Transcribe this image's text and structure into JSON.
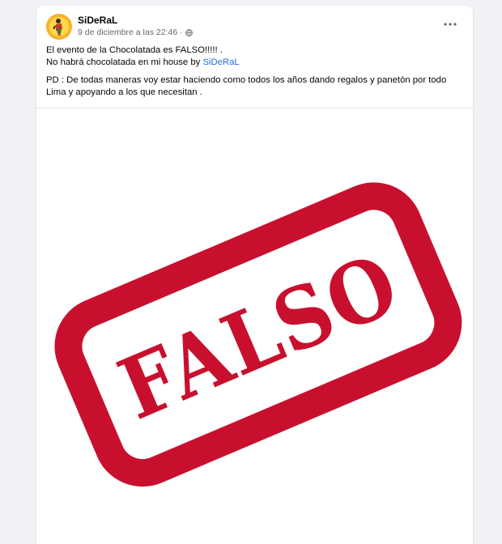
{
  "post": {
    "author": "SiDeRaL",
    "timestamp": "9 de diciembre a las 22:46",
    "separator": "·",
    "line1": "El evento de la Chocolatada es FALSO!!!!! .",
    "line2_prefix": "No habrá chocolatada en mi house by ",
    "line2_mention": "SiDeRaL",
    "paragraph2": "PD : De todas maneras voy estar haciendo como todos los años dando regalos y panetón por todo Lima y apoyando a los que necesitan .",
    "icons": {
      "privacy": "globe-icon",
      "menu": "more-options-icon"
    }
  },
  "image": {
    "stamp_text": "FALSO",
    "stamp_color": "#c8102e"
  }
}
